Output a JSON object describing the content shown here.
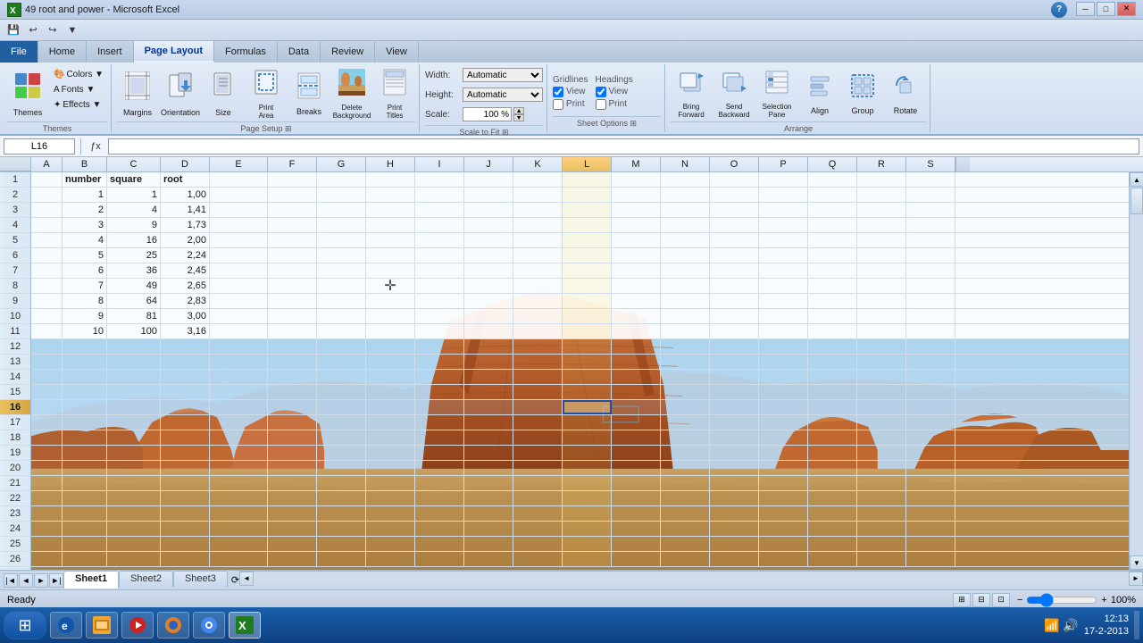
{
  "titleBar": {
    "title": "49 root and power - Microsoft Excel",
    "icon": "X",
    "controls": [
      "─",
      "□",
      "✕"
    ]
  },
  "quickAccess": {
    "buttons": [
      "💾",
      "↩",
      "↪",
      "▼"
    ]
  },
  "ribbonTabs": {
    "tabs": [
      "File",
      "Home",
      "Insert",
      "Page Layout",
      "Formulas",
      "Data",
      "Review",
      "View"
    ],
    "activeTab": "Page Layout"
  },
  "ribbon": {
    "groups": [
      {
        "name": "Themes",
        "buttons": [
          {
            "label": "Themes",
            "icon": "🎨",
            "large": true
          },
          {
            "label": "Colors ▼",
            "small": true
          },
          {
            "label": "Fonts ▼",
            "small": true
          },
          {
            "label": "Effects ▼",
            "small": true
          }
        ]
      },
      {
        "name": "Page Setup",
        "buttons": [
          {
            "label": "Margins",
            "icon": "▤",
            "large": true
          },
          {
            "label": "Orientation",
            "icon": "🔄",
            "large": true
          },
          {
            "label": "Size",
            "icon": "📄",
            "large": true
          },
          {
            "label": "Print Area",
            "icon": "⬜",
            "large": true
          },
          {
            "label": "Breaks",
            "icon": "✂",
            "large": true
          },
          {
            "label": "Delete Background",
            "icon": "🖼",
            "large": true
          },
          {
            "label": "Print Titles",
            "icon": "🖨",
            "large": true
          }
        ]
      },
      {
        "name": "Scale to Fit",
        "width": {
          "label": "Width:",
          "value": "Automatic"
        },
        "height": {
          "label": "Height:",
          "value": "Automatic"
        },
        "scale": {
          "label": "Scale:",
          "value": "100 %"
        }
      },
      {
        "name": "Sheet Options",
        "gridlines": {
          "view": true,
          "print": false
        },
        "headings": {
          "view": true,
          "print": false
        }
      },
      {
        "name": "Arrange",
        "buttons": [
          {
            "label": "Bring Forward",
            "icon": "⬆",
            "large": true
          },
          {
            "label": "Send Backward",
            "icon": "⬇",
            "large": true
          },
          {
            "label": "Selection Pane",
            "icon": "☰",
            "large": true
          },
          {
            "label": "Align",
            "icon": "≡",
            "large": true
          },
          {
            "label": "Group",
            "icon": "⊞",
            "large": true
          },
          {
            "label": "Rotate",
            "icon": "↻",
            "large": true
          }
        ]
      }
    ]
  },
  "formulaBar": {
    "cellRef": "L16",
    "formula": ""
  },
  "columns": {
    "rowHeader": "",
    "letters": [
      "A",
      "B",
      "C",
      "D",
      "E",
      "F",
      "G",
      "H",
      "I",
      "J",
      "K",
      "L",
      "M",
      "N",
      "O",
      "P",
      "Q",
      "R",
      "S"
    ],
    "widths": [
      35,
      50,
      60,
      55,
      65,
      55,
      55,
      55,
      55,
      55,
      55,
      55,
      55,
      55,
      55,
      55,
      55,
      55,
      55
    ]
  },
  "rows": [
    {
      "num": 1,
      "cells": [
        "",
        "number",
        "square",
        "root",
        "",
        "",
        "",
        "",
        "",
        "",
        "",
        "",
        "",
        "",
        "",
        "",
        "",
        "",
        ""
      ]
    },
    {
      "num": 2,
      "cells": [
        "",
        "1",
        "1",
        "1,00",
        "",
        "",
        "",
        "",
        "",
        "",
        "",
        "",
        "",
        "",
        "",
        "",
        "",
        "",
        ""
      ]
    },
    {
      "num": 3,
      "cells": [
        "",
        "2",
        "4",
        "1,41",
        "",
        "",
        "",
        "",
        "",
        "",
        "",
        "",
        "",
        "",
        "",
        "",
        "",
        "",
        ""
      ]
    },
    {
      "num": 4,
      "cells": [
        "",
        "3",
        "9",
        "1,73",
        "",
        "",
        "",
        "",
        "",
        "",
        "",
        "",
        "",
        "",
        "",
        "",
        "",
        "",
        ""
      ]
    },
    {
      "num": 5,
      "cells": [
        "",
        "4",
        "16",
        "2,00",
        "",
        "",
        "",
        "",
        "",
        "",
        "",
        "",
        "",
        "",
        "",
        "",
        "",
        "",
        ""
      ]
    },
    {
      "num": 6,
      "cells": [
        "",
        "5",
        "25",
        "2,24",
        "",
        "",
        "",
        "",
        "",
        "",
        "",
        "",
        "",
        "",
        "",
        "",
        "",
        "",
        ""
      ]
    },
    {
      "num": 7,
      "cells": [
        "",
        "6",
        "36",
        "2,45",
        "",
        "",
        "",
        "",
        "",
        "",
        "",
        "",
        "",
        "",
        "",
        "",
        "",
        "",
        ""
      ]
    },
    {
      "num": 8,
      "cells": [
        "",
        "7",
        "49",
        "2,65",
        "",
        "",
        "",
        "",
        "",
        "",
        "",
        "",
        "",
        "",
        "",
        "",
        "",
        "",
        ""
      ]
    },
    {
      "num": 9,
      "cells": [
        "",
        "8",
        "64",
        "2,83",
        "",
        "",
        "",
        "",
        "",
        "",
        "",
        "",
        "",
        "",
        "",
        "",
        "",
        "",
        ""
      ]
    },
    {
      "num": 10,
      "cells": [
        "",
        "9",
        "81",
        "3,00",
        "",
        "",
        "",
        "",
        "",
        "",
        "",
        "",
        "",
        "",
        "",
        "",
        "",
        "",
        ""
      ]
    },
    {
      "num": 11,
      "cells": [
        "",
        "10",
        "100",
        "3,16",
        "",
        "",
        "",
        "",
        "",
        "",
        "",
        "",
        "",
        "",
        "",
        "",
        "",
        "",
        ""
      ]
    },
    {
      "num": 12,
      "cells": [
        "",
        "",
        "",
        "",
        "",
        "",
        "",
        "",
        "",
        "",
        "",
        "",
        "",
        "",
        "",
        "",
        "",
        "",
        ""
      ]
    },
    {
      "num": 13,
      "cells": [
        "",
        "",
        "",
        "",
        "",
        "",
        "",
        "",
        "",
        "",
        "",
        "",
        "",
        "",
        "",
        "",
        "",
        "",
        ""
      ]
    },
    {
      "num": 14,
      "cells": [
        "",
        "",
        "",
        "",
        "",
        "",
        "",
        "",
        "",
        "",
        "",
        "",
        "",
        "",
        "",
        "",
        "",
        "",
        ""
      ]
    },
    {
      "num": 15,
      "cells": [
        "",
        "",
        "",
        "",
        "",
        "",
        "",
        "",
        "",
        "",
        "",
        "",
        "",
        "",
        "",
        "",
        "",
        "",
        ""
      ]
    },
    {
      "num": 16,
      "cells": [
        "",
        "",
        "",
        "",
        "",
        "",
        "",
        "",
        "",
        "",
        "",
        "",
        "",
        "",
        "",
        "",
        "",
        "",
        ""
      ]
    },
    {
      "num": 17,
      "cells": [
        "",
        "",
        "",
        "",
        "",
        "",
        "",
        "",
        "",
        "",
        "",
        "",
        "",
        "",
        "",
        "",
        "",
        "",
        ""
      ]
    },
    {
      "num": 18,
      "cells": [
        "",
        "",
        "",
        "",
        "",
        "",
        "",
        "",
        "",
        "",
        "",
        "",
        "",
        "",
        "",
        "",
        "",
        "",
        ""
      ]
    },
    {
      "num": 19,
      "cells": [
        "",
        "",
        "",
        "",
        "",
        "",
        "",
        "",
        "",
        "",
        "",
        "",
        "",
        "",
        "",
        "",
        "",
        "",
        ""
      ]
    },
    {
      "num": 20,
      "cells": [
        "",
        "",
        "",
        "",
        "",
        "",
        "",
        "",
        "",
        "",
        "",
        "",
        "",
        "",
        "",
        "",
        "",
        "",
        ""
      ]
    },
    {
      "num": 21,
      "cells": [
        "",
        "",
        "",
        "",
        "",
        "",
        "",
        "",
        "",
        "",
        "",
        "",
        "",
        "",
        "",
        "",
        "",
        "",
        ""
      ]
    },
    {
      "num": 22,
      "cells": [
        "",
        "",
        "",
        "",
        "",
        "",
        "",
        "",
        "",
        "",
        "",
        "",
        "",
        "",
        "",
        "",
        "",
        "",
        ""
      ]
    },
    {
      "num": 23,
      "cells": [
        "",
        "",
        "",
        "",
        "",
        "",
        "",
        "",
        "",
        "",
        "",
        "",
        "",
        "",
        "",
        "",
        "",
        "",
        ""
      ]
    },
    {
      "num": 24,
      "cells": [
        "",
        "",
        "",
        "",
        "",
        "",
        "",
        "",
        "",
        "",
        "",
        "",
        "",
        "",
        "",
        "",
        "",
        "",
        ""
      ]
    },
    {
      "num": 25,
      "cells": [
        "",
        "",
        "",
        "",
        "",
        "",
        "",
        "",
        "",
        "",
        "",
        "",
        "",
        "",
        "",
        "",
        "",
        "",
        ""
      ]
    }
  ],
  "activeCell": "L16",
  "activeRow": 16,
  "activeCol": "L",
  "sheetTabs": [
    "Sheet1",
    "Sheet2",
    "Sheet3"
  ],
  "activeSheet": "Sheet1",
  "statusBar": {
    "status": "Ready",
    "zoom": "100%",
    "date": "17-2-2013",
    "time": "12:13"
  }
}
